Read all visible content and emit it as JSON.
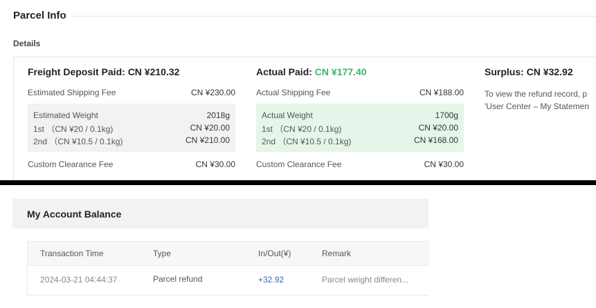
{
  "parcel": {
    "title": "Parcel Info",
    "details_label": "Details"
  },
  "freight": {
    "heading_label": "Freight Deposit Paid:",
    "heading_value": "CN ¥210.32",
    "estimated_shipping_label": "Estimated Shipping Fee",
    "estimated_shipping_value": "CN ¥230.00",
    "weight_label": "Estimated Weight",
    "weight_value": "2018g",
    "first_label": "1st （CN ¥20 / 0.1kg)",
    "first_value": "CN ¥20.00",
    "second_label": "2nd （CN ¥10.5 / 0.1kg)",
    "second_value": "CN ¥210.00",
    "customs_label": "Custom Clearance Fee",
    "customs_value": "CN ¥30.00"
  },
  "actual": {
    "heading_label": "Actual Paid:",
    "heading_value": "CN ¥177.40",
    "shipping_label": "Actual Shipping Fee",
    "shipping_value": "CN ¥188.00",
    "weight_label": "Actual Weight",
    "weight_value": "1700g",
    "first_label": "1st （CN ¥20 / 0.1kg)",
    "first_value": "CN ¥20.00",
    "second_label": "2nd （CN ¥10.5 / 0.1kg)",
    "second_value": "CN ¥168.00",
    "customs_label": "Custom Clearance Fee",
    "customs_value": "CN ¥30.00"
  },
  "surplus": {
    "heading_label": "Surplus:",
    "heading_value": "CN ¥32.92",
    "line1": "To view the refund record, p",
    "line2": "'User Center – My Statemen"
  },
  "balance": {
    "title": "My Account Balance",
    "columns": [
      "Transaction Time",
      "Type",
      "In/Out(¥)",
      "Remark"
    ],
    "rows": [
      {
        "time": "2024-03-21 04:44:37",
        "type": "Parcel refund",
        "amount": "+32.92",
        "remark": "Parcel weight differen..."
      }
    ]
  },
  "colors": {
    "accent_green": "#3db568",
    "link_blue": "#2e6bb5"
  }
}
